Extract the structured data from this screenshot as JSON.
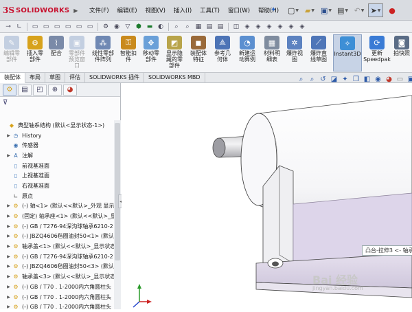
{
  "app": {
    "logo_ds": "3S",
    "logo_name": "SOLIDWORKS"
  },
  "menu": [
    "文件(F)",
    "编辑(E)",
    "视图(V)",
    "插入(I)",
    "工具(T)",
    "窗口(W)",
    "帮助(H)"
  ],
  "ribbon": [
    {
      "label": "编辑零\n部件",
      "color": "#8aa3c8",
      "disabled": true
    },
    {
      "label": "插入零\n部件",
      "color": "#d7a21c"
    },
    {
      "label": "配合",
      "color": "#7a8aa8"
    },
    {
      "label": "零部件\n预览窗\n口",
      "color": "#8aa3c8",
      "disabled": true
    },
    {
      "label": "线性零部\n件阵列",
      "color": "#6f88b3"
    },
    {
      "label": "智能扣\n件",
      "color": "#c98a1d"
    },
    {
      "label": "移动零\n部件",
      "color": "#6aa0d8"
    },
    {
      "label": "显示隐\n藏的零\n部件",
      "color": "#b8a44a"
    },
    {
      "label": "装配体\n特征",
      "color": "#9a6a3a"
    },
    {
      "label": "参考几\n何体",
      "color": "#4d74b6"
    },
    {
      "label": "新建运\n动算例",
      "color": "#5b8fd0"
    },
    {
      "label": "材料明\n细表",
      "color": "#7f8c9f"
    },
    {
      "label": "爆炸视\n图",
      "color": "#5c82c0"
    },
    {
      "label": "爆炸直\n线草图",
      "color": "#4f76b8"
    },
    {
      "label": "Instant3D",
      "color": "#3e8fd6",
      "active": true
    },
    {
      "label": "更新\nSpeedpak",
      "color": "#3a7bd5"
    },
    {
      "label": "拍快照",
      "color": "#5a6c86"
    }
  ],
  "command_tabs": [
    "装配体",
    "布局",
    "草图",
    "评估",
    "SOLIDWORKS 插件",
    "SOLIDWORKS MBD"
  ],
  "tree": [
    {
      "text": "典型轴系结构 (默认<显示状态-1>)",
      "icon": "asm",
      "lvl": 0,
      "exp": ""
    },
    {
      "text": "History",
      "icon": "hist",
      "lvl": 1,
      "exp": "▶"
    },
    {
      "text": "传感器",
      "icon": "sensor",
      "lvl": 1,
      "exp": ""
    },
    {
      "text": "注解",
      "icon": "note",
      "lvl": 1,
      "exp": "▶"
    },
    {
      "text": "前视基准面",
      "icon": "plane",
      "lvl": 1,
      "exp": ""
    },
    {
      "text": "上视基准面",
      "icon": "plane",
      "lvl": 1,
      "exp": ""
    },
    {
      "text": "右视基准面",
      "icon": "plane",
      "lvl": 1,
      "exp": ""
    },
    {
      "text": "原点",
      "icon": "origin",
      "lvl": 1,
      "exp": ""
    },
    {
      "text": "(-) 轴<1> (默认<<默认>_外观 显示",
      "icon": "gear",
      "lvl": 1,
      "exp": "▶"
    },
    {
      "text": "(固定) 轴承座<1> (默认<<默认>_显",
      "icon": "gear",
      "lvl": 1,
      "exp": "▶"
    },
    {
      "text": "(-) GB / T276-94深沟球轴承6210-2",
      "icon": "gear",
      "lvl": 1,
      "exp": "▶"
    },
    {
      "text": "(-) JBZQ4606毡圈油封50<1> (默认",
      "icon": "gear",
      "lvl": 1,
      "exp": "▶"
    },
    {
      "text": "轴承盖<1> (默认<<默认>_显示状态",
      "icon": "gear",
      "lvl": 1,
      "exp": "▶"
    },
    {
      "text": "(-) GB / T276-94深沟球轴承6210-2",
      "icon": "gear",
      "lvl": 1,
      "exp": "▶"
    },
    {
      "text": "(-) JBZQ4606毡圈油封50<3> (默认",
      "icon": "gear",
      "lvl": 1,
      "exp": "▶"
    },
    {
      "text": "轴承盖<3> (默认<<默认>_显示状态",
      "icon": "gear",
      "lvl": 1,
      "exp": "▶"
    },
    {
      "text": "(-) GB / T70 . 1-2000内六角圆柱头",
      "icon": "gear",
      "lvl": 1,
      "exp": "▶"
    },
    {
      "text": "(-) GB / T70 . 1-2000内六角圆柱头",
      "icon": "gear",
      "lvl": 1,
      "exp": "▶"
    },
    {
      "text": "(-) GB / T70 . 1-2000内六角圆柱头",
      "icon": "gear",
      "lvl": 1,
      "exp": "▶"
    }
  ],
  "tooltip": "凸台-拉伸3 <- 轴承",
  "watermark": {
    "text": "Bai 经验",
    "url": "jingyan.baidu.com"
  },
  "colors": {
    "accent": "#2d5aa8",
    "brand": "#c8102e"
  }
}
